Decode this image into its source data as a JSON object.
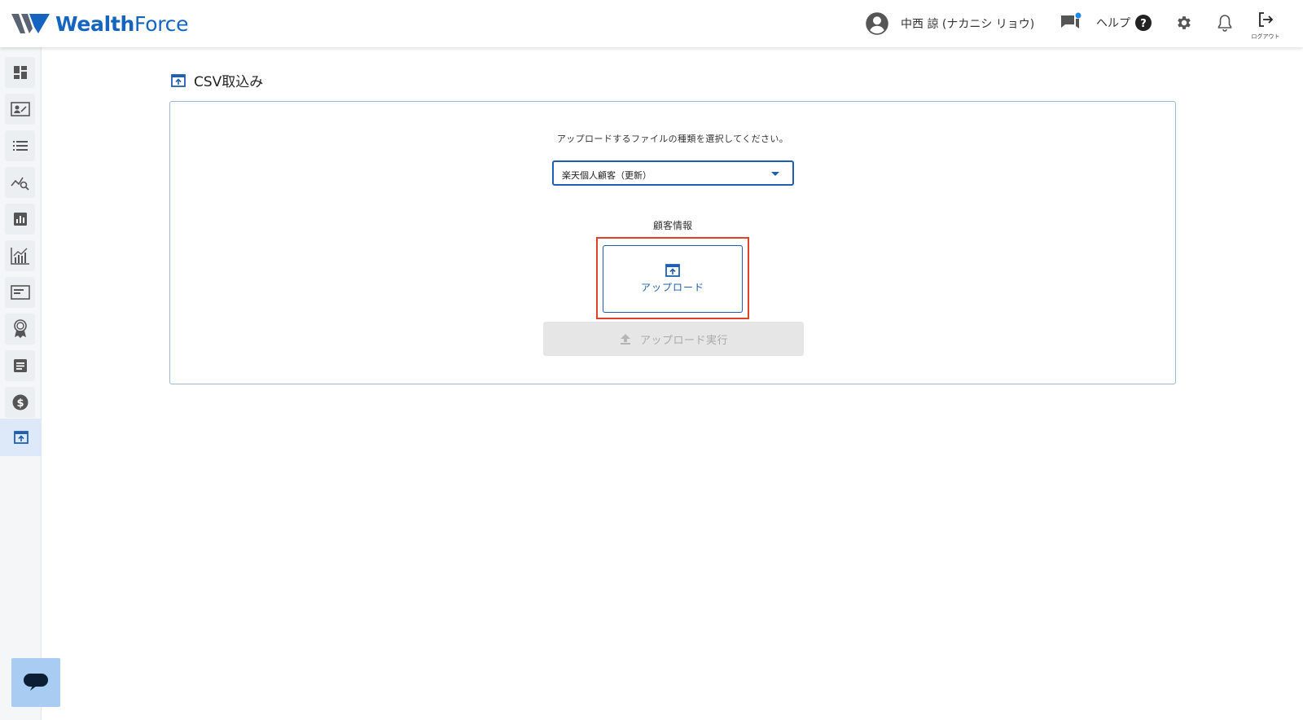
{
  "header": {
    "logo_text_bold": "Wealth",
    "logo_text_light": "Force",
    "user_name": "中西 諒 (ナカニシ リョウ)",
    "help_label": "ヘルプ",
    "logout_label": "ログアウト"
  },
  "sidebar": {
    "items": [
      {
        "icon": "dashboard-icon"
      },
      {
        "icon": "contact-card-icon"
      },
      {
        "icon": "list-icon"
      },
      {
        "icon": "analytics-search-icon"
      },
      {
        "icon": "bar-chart-icon"
      },
      {
        "icon": "growth-chart-icon"
      },
      {
        "icon": "message-box-icon"
      },
      {
        "icon": "award-icon"
      },
      {
        "icon": "document-icon"
      },
      {
        "icon": "dollar-icon"
      },
      {
        "icon": "upload-icon",
        "active": true
      }
    ]
  },
  "page": {
    "title": "CSV取込み",
    "instruction": "アップロードするファイルの種類を選択してください。",
    "file_type_selected": "楽天個人顧客（更新）",
    "section_label": "顧客情報",
    "upload_button_label": "アップロード",
    "execute_button_label": "アップロード実行"
  },
  "colors": {
    "brand": "#1565c0",
    "accent": "#1e5fb3",
    "highlight": "#e0432a",
    "disabled_bg": "#e6e6e6"
  }
}
